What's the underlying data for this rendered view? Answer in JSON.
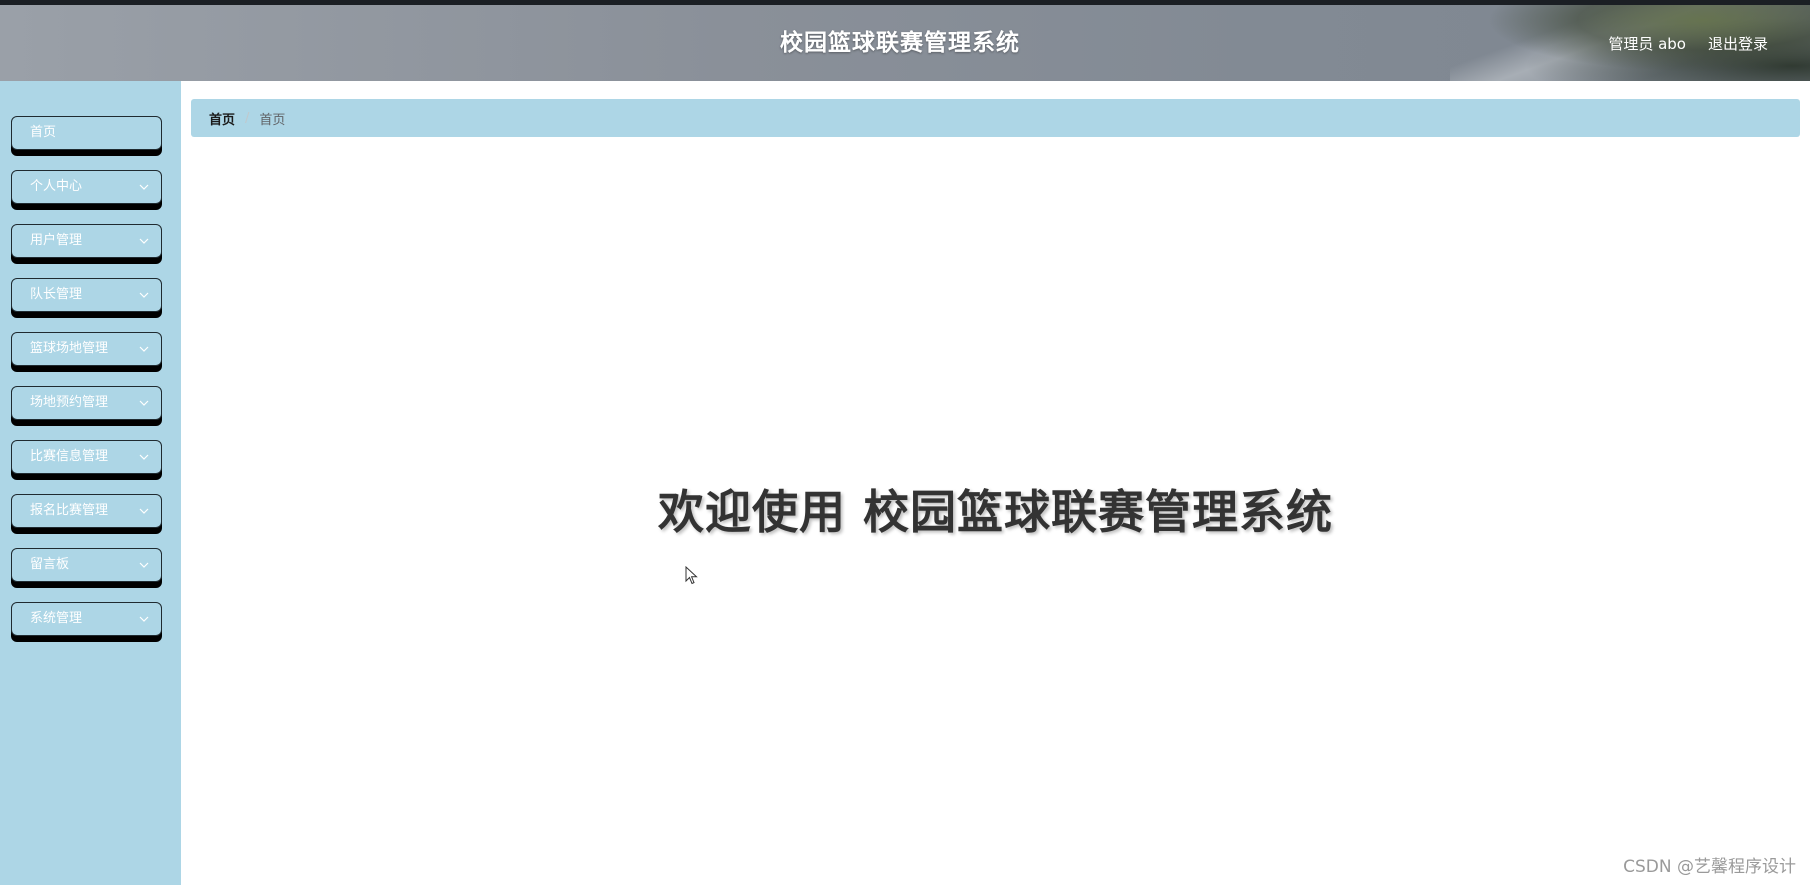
{
  "header": {
    "title": "校园篮球联赛管理系统",
    "user_label": "管理员 abo",
    "logout_label": "退出登录"
  },
  "sidebar": {
    "items": [
      {
        "label": "首页",
        "has_submenu": false
      },
      {
        "label": "个人中心",
        "has_submenu": true
      },
      {
        "label": "用户管理",
        "has_submenu": true
      },
      {
        "label": "队长管理",
        "has_submenu": true
      },
      {
        "label": "篮球场地管理",
        "has_submenu": true
      },
      {
        "label": "场地预约管理",
        "has_submenu": true
      },
      {
        "label": "比赛信息管理",
        "has_submenu": true
      },
      {
        "label": "报名比赛管理",
        "has_submenu": true
      },
      {
        "label": "留言板",
        "has_submenu": true
      },
      {
        "label": "系统管理",
        "has_submenu": true
      }
    ]
  },
  "breadcrumb": {
    "home": "首页",
    "separator": "/",
    "current": "首页"
  },
  "main": {
    "welcome": "欢迎使用 校园篮球联赛管理系统"
  },
  "watermark": "CSDN @艺馨程序设计",
  "colors": {
    "accent": "#add6e6",
    "header": "#868d96",
    "text_dark": "#333333"
  }
}
